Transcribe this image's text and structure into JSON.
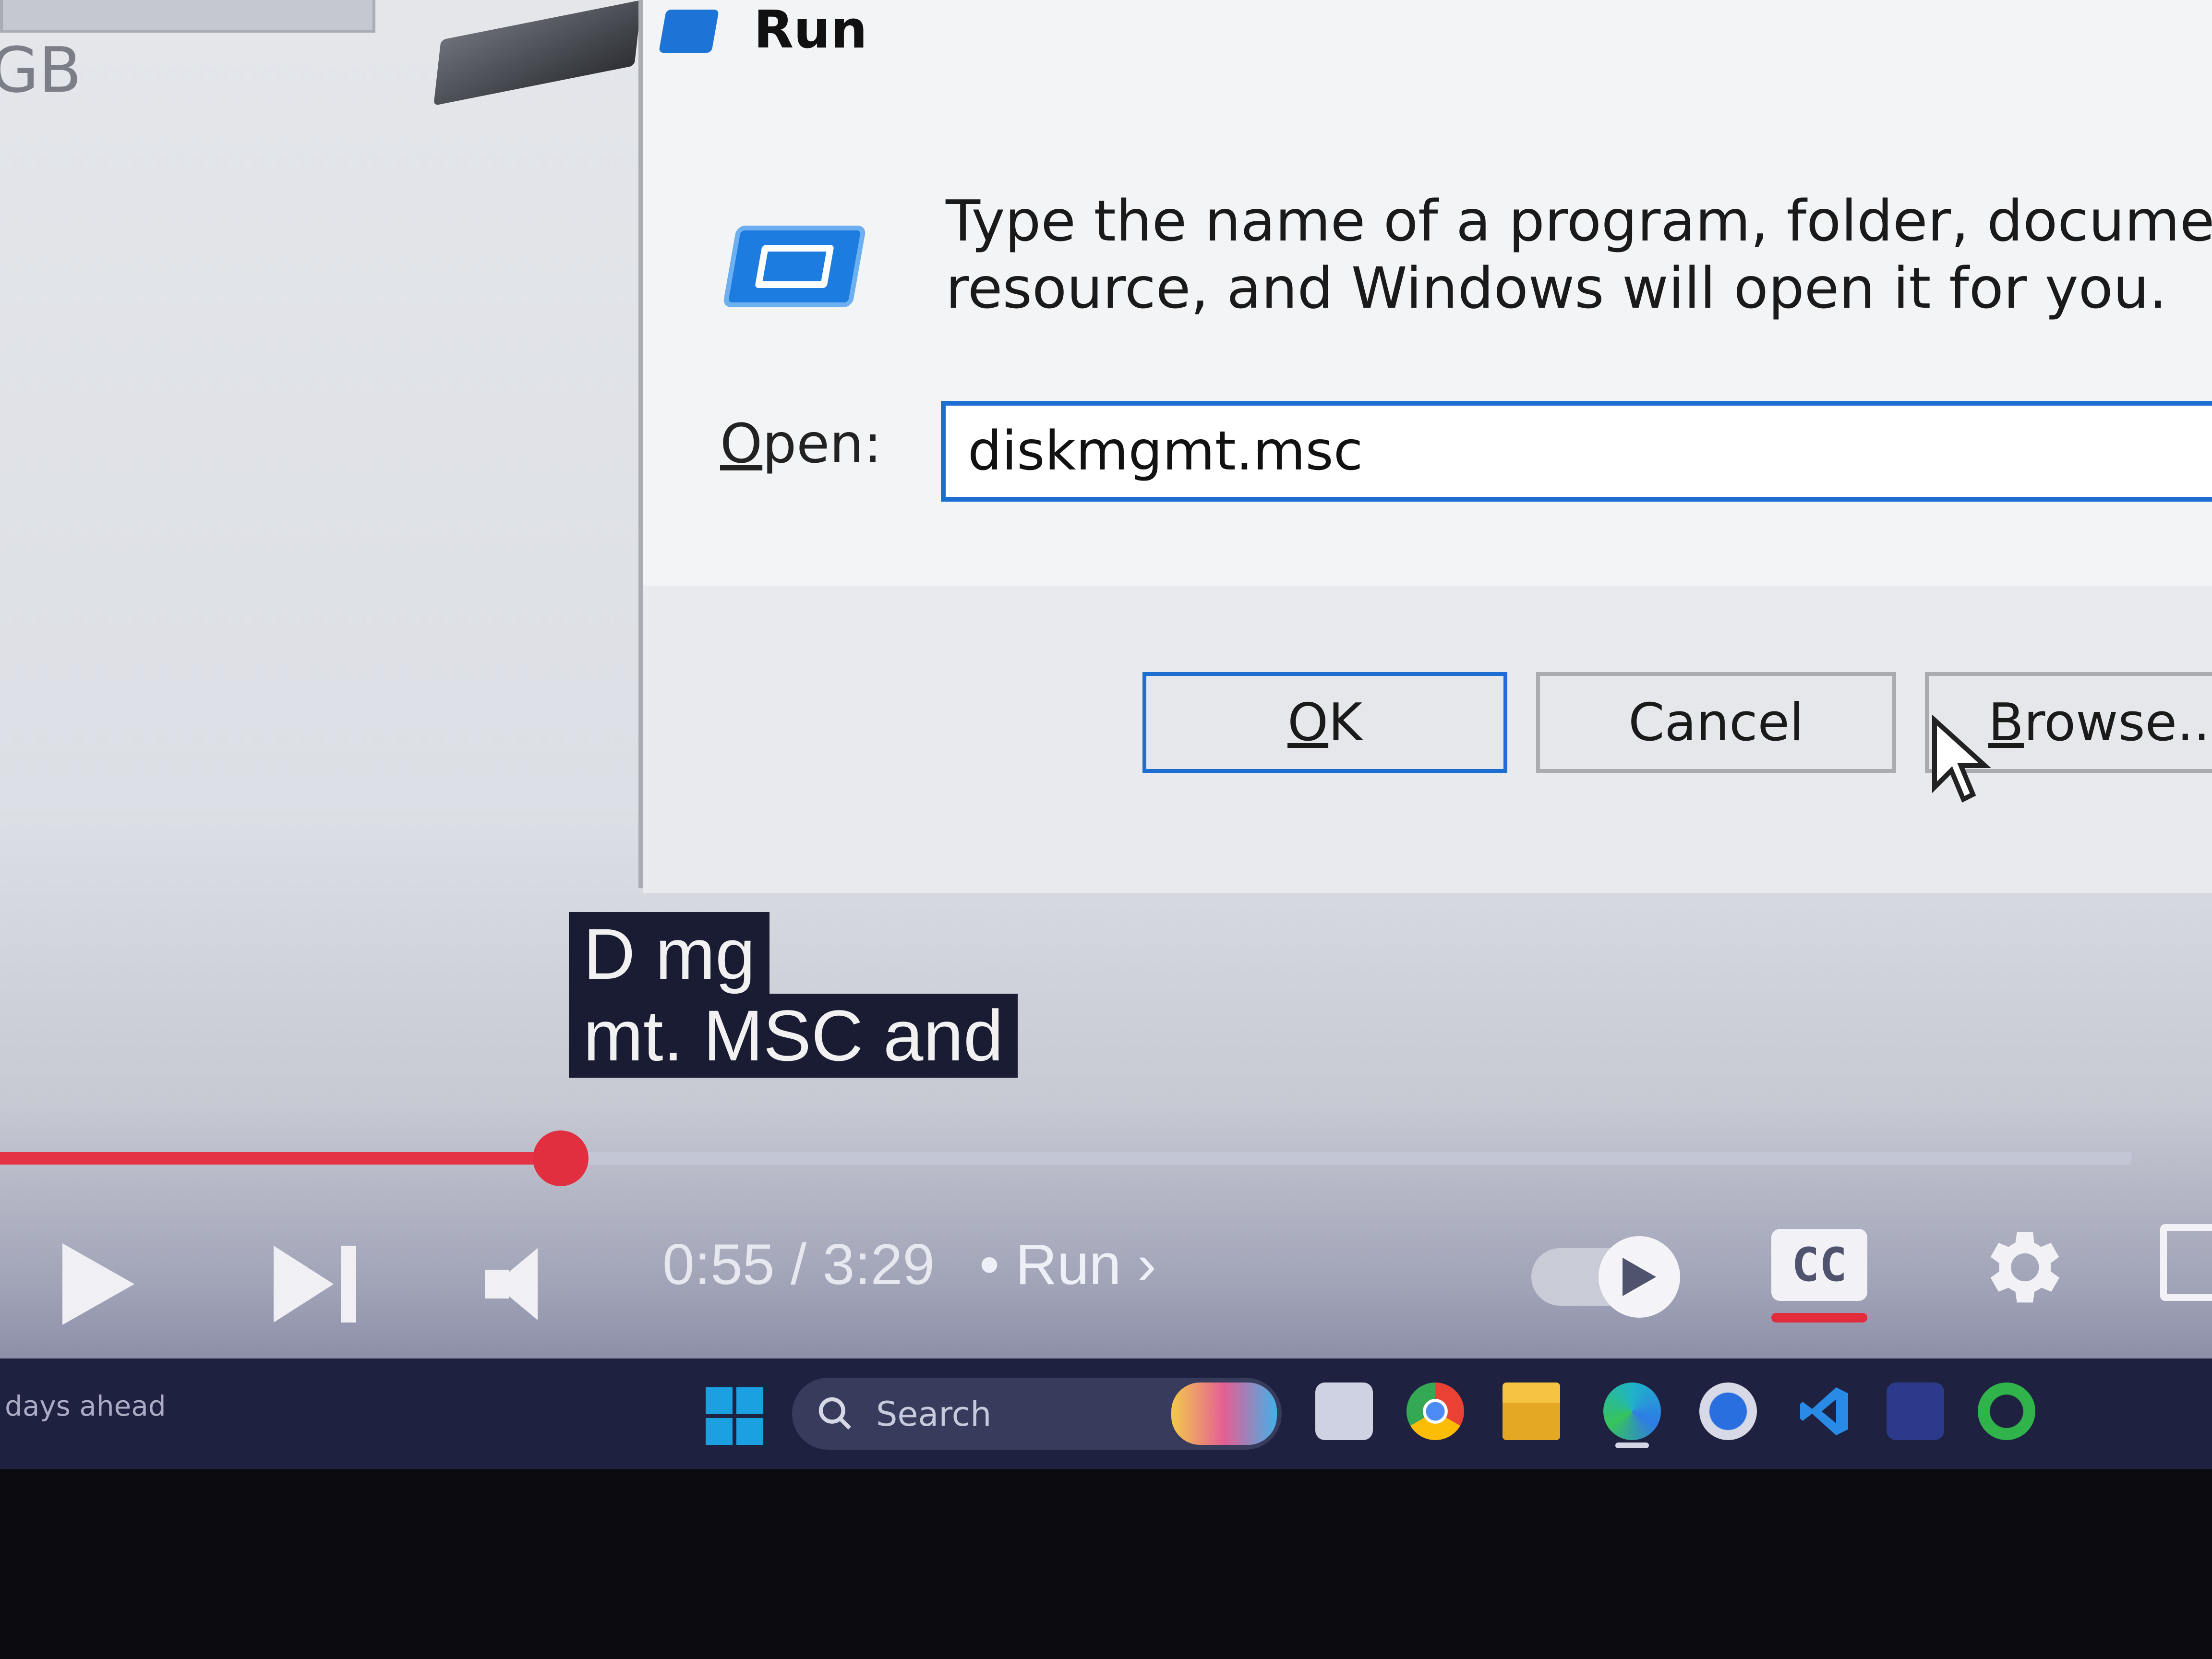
{
  "background": {
    "drive_size_label": "GB"
  },
  "run_dialog": {
    "title": "Run",
    "description": "Type the name of a program, folder, document, or Interne resource, and Windows will open it for you.",
    "description_line1": "Type the name of a program, folder, document, or Interne",
    "description_line2": "resource, and Windows will open it for you.",
    "open_label_underlined": "O",
    "open_label_rest": "pen:",
    "input_value": "diskmgmt.msc",
    "ok_label_underlined": "O",
    "ok_label_rest": "K",
    "cancel_label": "Cancel",
    "browse_label_underlined": "B",
    "browse_label_rest": "rowse..."
  },
  "captions": {
    "line1": "D mg",
    "line2": "mt. MSC and"
  },
  "player": {
    "progress_fraction": 0.263,
    "time_display": "0:55 / 3:29",
    "chapter_separator": "•",
    "chapter": "Run",
    "chapter_chevron": "›",
    "cc_label": "CC",
    "autoplay_on": true,
    "accent_color": "#e43344"
  },
  "taskbar": {
    "weather_text": "days ahead",
    "search_placeholder": "Search",
    "apps": [
      "task-view",
      "chrome",
      "file-explorer",
      "edge",
      "store",
      "vscode",
      "app",
      "whatsapp"
    ]
  }
}
